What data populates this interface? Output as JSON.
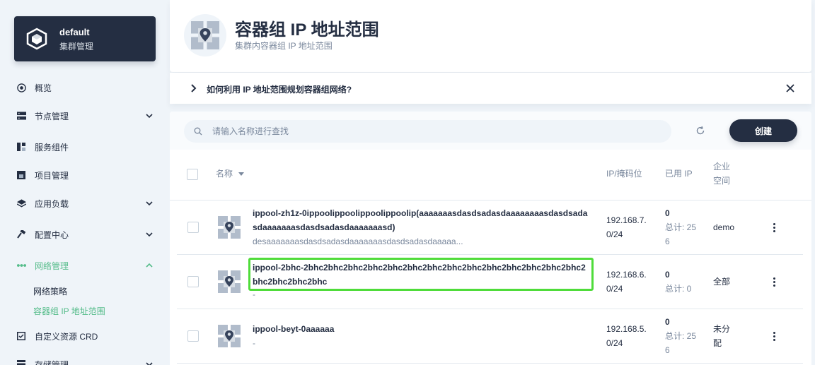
{
  "cluster": {
    "name": "default",
    "subtitle": "集群管理"
  },
  "nav": {
    "overview": "概览",
    "nodes": "节点管理",
    "components": "服务组件",
    "projects": "项目管理",
    "workloads": "应用负载",
    "config": "配置中心",
    "network": "网络管理",
    "network_policies": "网络策略",
    "ip_pools": "容器组 IP 地址范围",
    "crd": "自定义资源 CRD",
    "storage": "存储管理"
  },
  "header": {
    "title": "容器组 IP 地址范围",
    "description": "集群内容器组 IP 地址范围"
  },
  "tips": {
    "text": "如何利用 IP 地址范围规划容器组网络?"
  },
  "toolbar": {
    "search_placeholder": "请输入名称进行查找",
    "create_label": "创建"
  },
  "table": {
    "columns": {
      "name": "名称",
      "ip_mask": "IP/掩码位",
      "used_ip": "已用 IP",
      "workspace_line1": "企业",
      "workspace_line2": "空间"
    },
    "rows": [
      {
        "name": "ippool-zh1z-0ippoolippoolippoolippoolip(aaaaaaasdasdsadasdaaaaaaaasdasdsadasdaaaaaaasdasdsadasdaaaaaaasd)",
        "description": "desaaaaaaasdasdsadasdaaaaaaasdasdsadasdaaaaa...",
        "ip": "192.168.7.0/24",
        "used": "0",
        "total": "总计: 256",
        "workspace": "demo"
      },
      {
        "name": "ippool-2bhc-2bhc2bhc2bhc2bhc2bhc2bhc2bhc2bhc2bhc2bhc2bhc2bhc2bhc2bhc2bhc2bhc2bhc2bhc",
        "description": "-",
        "ip": "192.168.6.0/24",
        "used": "0",
        "total": "总计: 0",
        "workspace": "全部"
      },
      {
        "name": "ippool-beyt-0aaaaaa",
        "description": "-",
        "ip": "192.168.5.0/24",
        "used": "0",
        "total": "总计: 256",
        "workspace": "未分配"
      }
    ]
  },
  "colors": {
    "accent": "#55bc8a",
    "dark": "#242e42",
    "highlight": "#4fdc3a",
    "muted": "#79879c"
  }
}
